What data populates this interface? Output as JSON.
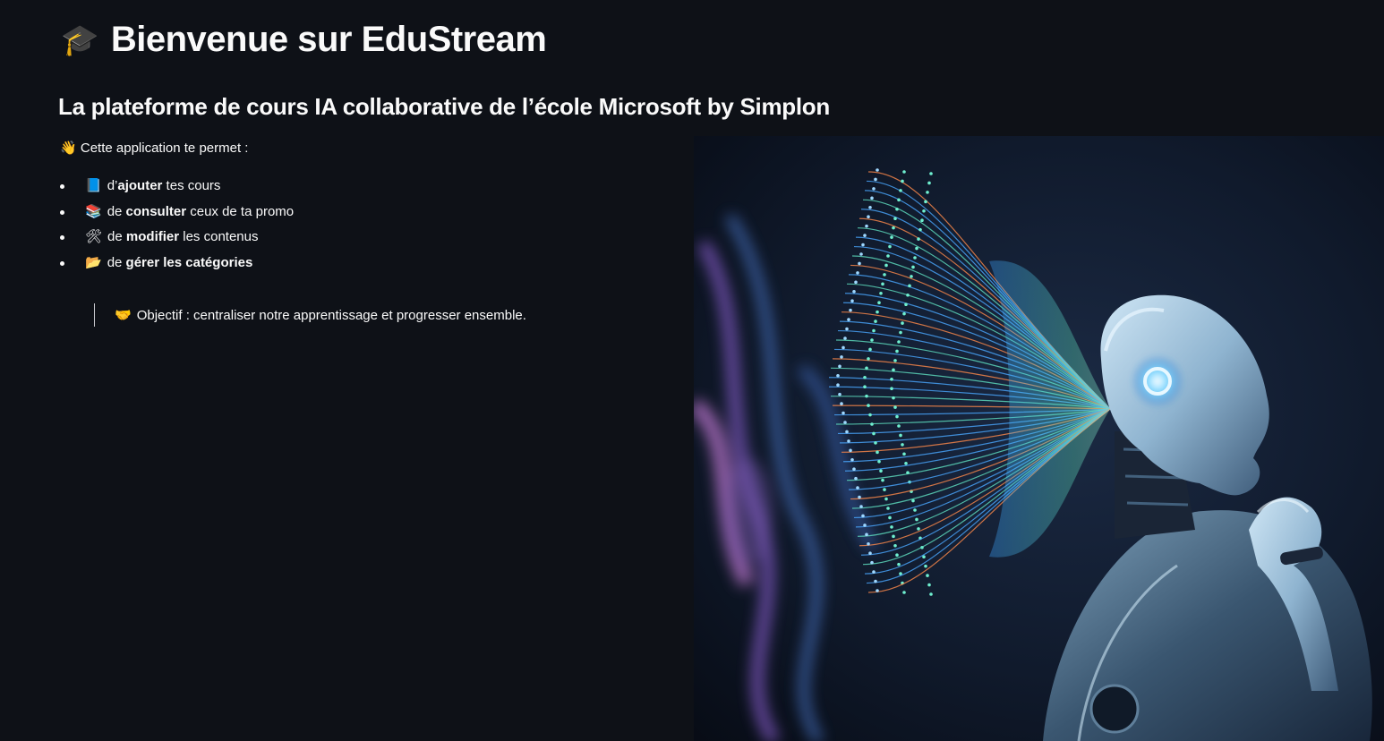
{
  "header": {
    "title_icon": "graduation-cap-icon",
    "title_emoji": "🎓",
    "title": "Bienvenue sur EduStream",
    "subtitle": "La plateforme de cours IA collaborative de l’école Microsoft by Simplon"
  },
  "intro": {
    "icon": "waving-hand-icon",
    "emoji": "👋",
    "text": "Cette application te permet :"
  },
  "features": [
    {
      "icon": "blue-book-icon",
      "emoji": "📘",
      "pre": "d’",
      "bold": "ajouter",
      "post": " tes cours"
    },
    {
      "icon": "books-icon",
      "emoji": "📚",
      "pre": "de ",
      "bold": "consulter",
      "post": " ceux de ta promo"
    },
    {
      "icon": "tools-icon",
      "emoji": "🛠",
      "pre": "de ",
      "bold": "modifier",
      "post": " les contenus"
    },
    {
      "icon": "folder-icon",
      "emoji": "📂",
      "pre": "de ",
      "bold": "gérer les catégories",
      "post": ""
    }
  ],
  "objective": {
    "icon": "handshake-icon",
    "emoji": "🤝",
    "text": "Objectif : centraliser notre apprentissage et progresser ensemble."
  },
  "hero_image": {
    "subject": "ai-robot-thinking-illustration"
  },
  "colors": {
    "background": "#0e1117",
    "text": "#fafafa",
    "quote_border": "#c9cad0"
  }
}
